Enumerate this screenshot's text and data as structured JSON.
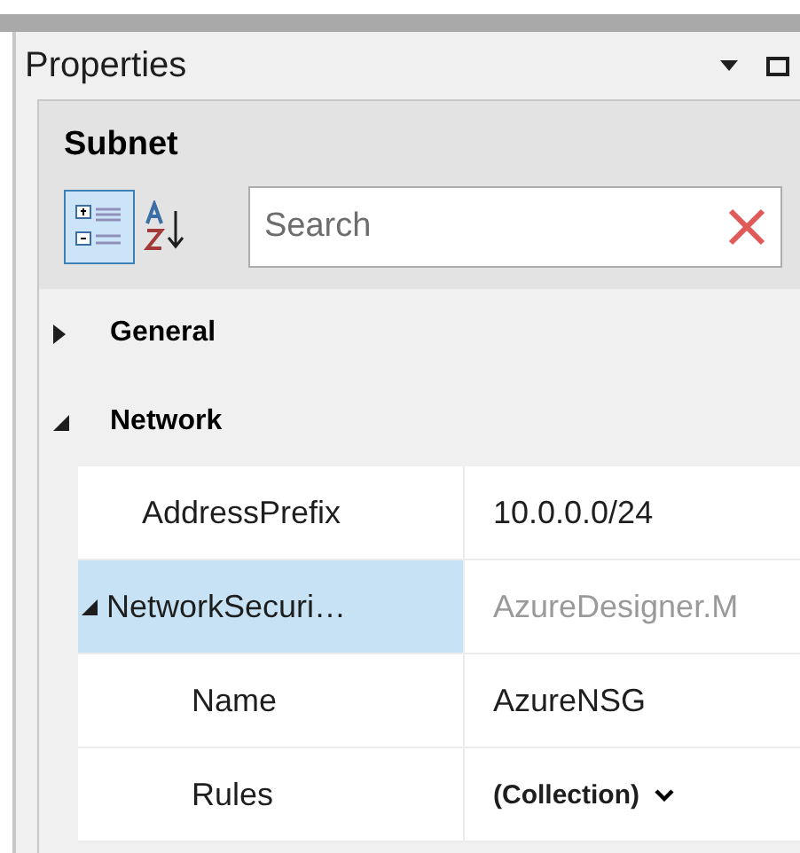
{
  "panel": {
    "title": "Properties"
  },
  "object": {
    "name": "Subnet"
  },
  "toolbar": [
    {
      "kind": "categorized",
      "selected": true
    },
    {
      "kind": "alphabetical",
      "selected": false
    }
  ],
  "search": {
    "placeholder": "Search"
  },
  "categories": [
    {
      "name": "General",
      "expanded": false
    },
    {
      "name": "Network",
      "expanded": true,
      "properties": [
        {
          "name": "AddressPrefix",
          "value": "10.0.0.0/24",
          "kind": "text",
          "selected": false
        },
        {
          "name": "NetworkSecuri…",
          "value": "AzureDesigner.M",
          "kind": "readonly",
          "selected": true,
          "expanded": true,
          "children": [
            {
              "name": "Name",
              "value": "AzureNSG",
              "kind": "text",
              "selected": false
            },
            {
              "name": "Rules",
              "value": "(Collection)",
              "kind": "collection",
              "selected": false
            }
          ]
        }
      ]
    }
  ]
}
